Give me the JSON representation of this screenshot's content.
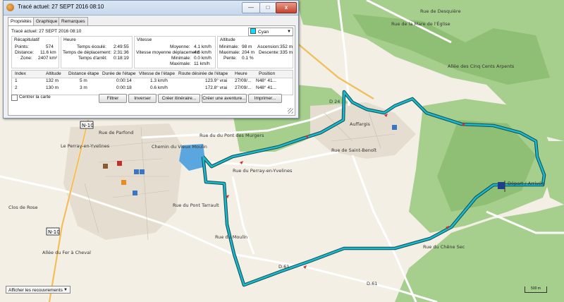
{
  "window": {
    "title": "Tracé actuel: 27 SEPT 2016 08:10",
    "min_label": "—",
    "max_label": "□",
    "close_label": "x"
  },
  "tabs": [
    {
      "label": "Propriétés",
      "active": true
    },
    {
      "label": "Graphique",
      "active": false
    },
    {
      "label": "Remarques",
      "active": false
    }
  ],
  "trace": {
    "label": "Tracé actuel: 27 SEPT 2016 08:10",
    "color_label": "Cyan",
    "color_hex": "#00e5ff"
  },
  "recap": {
    "title": "Récapitulatif",
    "points_label": "Points:",
    "points_value": "574",
    "distance_label": "Distance:",
    "distance_value": "11.6 km",
    "zone_label": "Zone:",
    "zone_value": "2407 km²"
  },
  "heure": {
    "title": "Heure",
    "ecoule_label": "Temps écoulé:",
    "ecoule_value": "2:49:55",
    "deplacement_label": "Temps de déplacement:",
    "deplacement_value": "2:31:36",
    "arret_label": "Temps d'arrêt:",
    "arret_value": "0:18:19"
  },
  "vitesse": {
    "title": "Vitesse",
    "moyenne_label": "Moyenne:",
    "moyenne_value": "4.1 km/h",
    "moy_dep_label": "Vitesse moyenne déplacement:",
    "moy_dep_value": "4.6 km/h",
    "min_label": "Minimale:",
    "min_value": "0.0 km/h",
    "max_label": "Maximale:",
    "max_value": "11 km/h"
  },
  "altitude": {
    "title": "Altitude",
    "min_label": "Minimale:",
    "min_value": "98 m",
    "max_label": "Maximale:",
    "max_value": "204 m",
    "pente_label": "Pente:",
    "pente_value": "0.1 %",
    "asc_label": "Ascension:",
    "asc_value": "352 m",
    "desc_label": "Descente:",
    "desc_value": "335 m"
  },
  "table": {
    "headers": [
      "Index",
      "Altitude",
      "Distance étape",
      "Durée de l'étape",
      "Vitesse de l'étape",
      "Route désirée de l'étape",
      "Heure",
      "Position"
    ],
    "rows": [
      [
        "1",
        "132 m",
        "5 m",
        "0:00:14",
        "1.3 km/h",
        "123.9° vrai",
        "27/09/...",
        "N48° 41..."
      ],
      [
        "2",
        "130 m",
        "3 m",
        "0:00:18",
        "0.6 km/h",
        "172.8° vrai",
        "27/09/...",
        "N48° 41..."
      ]
    ]
  },
  "buttons": {
    "center_label": "Centrer la carte",
    "filter_label": "Filtrer",
    "invert_label": "Inverser",
    "itinerary_label": "Créer itinéraire...",
    "adventure_label": "Créer une aventure...",
    "print_label": "Imprimer..."
  },
  "map_labels": {
    "road_n10_a": "N-10",
    "road_n10_b": "N-10",
    "road_d24": "D 24",
    "road_d61": "D.61",
    "road_d61_b": "D.61",
    "town_perray": "Le Perray-en-Yvelines",
    "town_auffargis": "Auffargis",
    "route_perray": "Rue du Perray-en-Yvelines",
    "route_pont_murgers": "Rue du du Pont des Murgers",
    "rue_parfond": "Rue de Parfond",
    "rue_chene": "Rue du Chêne Sec",
    "rue_pont_tarrault": "Rue du Pont Tarrault",
    "rue_moulin": "Rue du Moulin",
    "allee_cinq_cents": "Allée des Cinq Cents Arpents",
    "chemin_plaine": "Chemin du Vieux Moulin",
    "rue_mare": "Rue de la Mare de l'Église",
    "rue_desquiere": "Rue de Desquière",
    "rue_saint_benoit": "Rue de Saint-Benoît",
    "rue_chene_rouge": "Rue du Chêne Rouge",
    "rue_haras": "Rue du Haras",
    "allee_fer": "Allée du Fer à Cheval",
    "clos_rose": "Clos de Rose",
    "depart": "Départ / Arrivée"
  },
  "bottom": {
    "overlay_label": "Afficher les recouvrements",
    "scale_label": "500 m"
  },
  "colors": {
    "track": "#1fb6c9",
    "track_edge": "#0b4f57",
    "forest": "#8fc27a",
    "field": "#f3efe5",
    "water": "#5aa7e0"
  }
}
